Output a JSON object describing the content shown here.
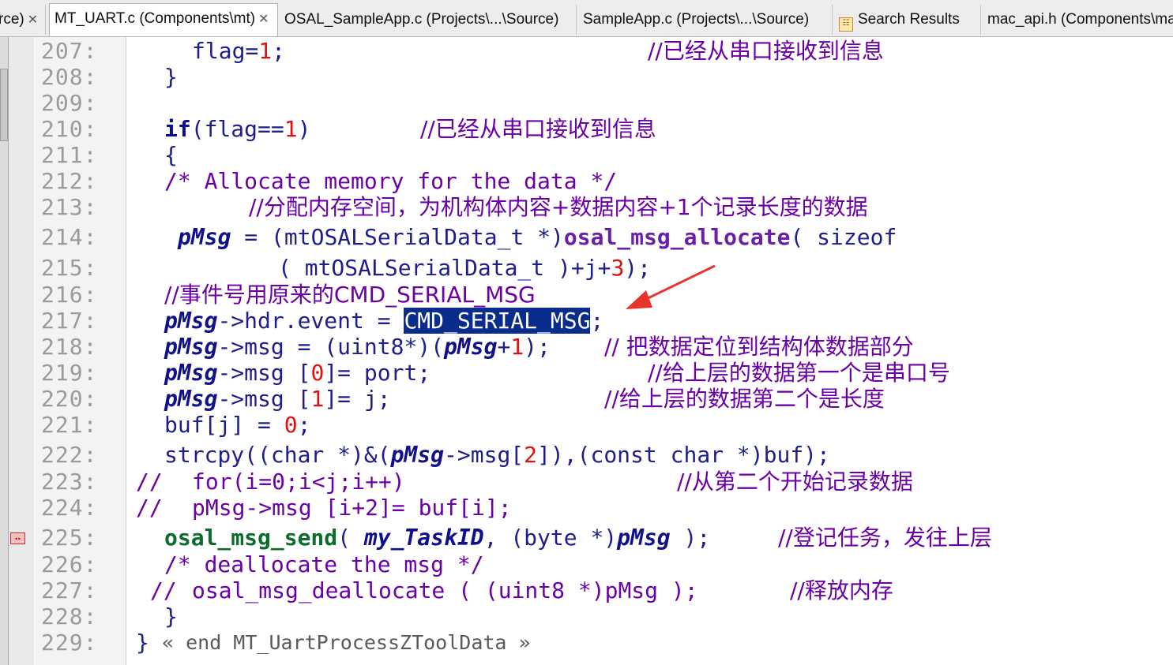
{
  "tabs": [
    {
      "label": "rce)",
      "closable": true
    },
    {
      "label": "MT_UART.c (Components\\mt)",
      "closable": true,
      "active": true
    },
    {
      "label": "OSAL_SampleApp.c (Projects\\...\\Source)",
      "closable": false
    },
    {
      "label": "SampleApp.c (Projects\\...\\Source)",
      "closable": false
    },
    {
      "label": "Search Results",
      "closable": false,
      "icon": "search-results-icon"
    },
    {
      "label": "mac_api.h (Components\\ma",
      "closable": false
    }
  ],
  "lines": [
    {
      "n": "207:"
    },
    {
      "n": "208:"
    },
    {
      "n": "209:"
    },
    {
      "n": "210:"
    },
    {
      "n": "211:"
    },
    {
      "n": "212:"
    },
    {
      "n": "213:"
    },
    {
      "n": "214:"
    },
    {
      "n": "215:"
    },
    {
      "n": "216:"
    },
    {
      "n": "217:"
    },
    {
      "n": "218:"
    },
    {
      "n": "219:"
    },
    {
      "n": "220:"
    },
    {
      "n": "221:"
    },
    {
      "n": "222:"
    },
    {
      "n": "223:"
    },
    {
      "n": "224:"
    },
    {
      "n": "225:"
    },
    {
      "n": "226:"
    },
    {
      "n": "227:"
    },
    {
      "n": "228:"
    },
    {
      "n": "229:"
    }
  ],
  "code": {
    "l207a": "flag=",
    "l207b": "1",
    "l207c": ";",
    "l207d": "//已经从串口接收到信息",
    "l208": "}",
    "l210a": "if",
    "l210b": "(flag==",
    "l210c": "1",
    "l210d": ")",
    "l210e": "//已经从串口接收到信息",
    "l211": "{",
    "l212": "/* Allocate memory for the data */",
    "l213": "//分配内存空间，为机构体内容+数据内容+1个记录长度的数据",
    "l214a": "pMsg",
    "l214b": " = (mtOSALSerialData_t *)",
    "l214c": "osal_msg_allocate",
    "l214d": "( sizeof",
    "l215a": "( mtOSALSerialData_t )+j+",
    "l215b": "3",
    "l215c": ");",
    "l216": "//事件号用原来的CMD_SERIAL_MSG",
    "l217a": "pMsg",
    "l217b": "->hdr.event = ",
    "l217c": "CMD_SERIAL_MSG",
    "l217d": ";",
    "l218a": "pMsg",
    "l218b": "->msg = (uint8*)(",
    "l218c": "pMsg",
    "l218d": "+",
    "l218e": "1",
    "l218f": ");",
    "l218g": "// 把数据定位到结构体数据部分",
    "l219a": "pMsg",
    "l219b": "->msg [",
    "l219c": "0",
    "l219d": "]= port;",
    "l219e": "//给上层的数据第一个是串口号",
    "l220a": "pMsg",
    "l220b": "->msg [",
    "l220c": "1",
    "l220d": "]= j;",
    "l220e": "//给上层的数据第二个是长度",
    "l221a": "buf[j] = ",
    "l221b": "0",
    "l221c": ";",
    "l222a": "strcpy((char *)&(",
    "l222b": "pMsg",
    "l222c": "->msg[",
    "l222d": "2",
    "l222e": "]),(const char *)buf);",
    "l223a": "//",
    "l223b": "for(i=0;i<j;i++)",
    "l223c": "//从第二个开始记录数据",
    "l224a": "//",
    "l224b": "pMsg->msg [i+2]= buf[i];",
    "l225a": "osal_msg_send",
    "l225b": "( ",
    "l225c": "my_TaskID",
    "l225d": ", (byte *)",
    "l225e": "pMsg",
    "l225f": " );",
    "l225g": "//登记任务，发往上层",
    "l226": "/* deallocate the msg */",
    "l227a": "//",
    "l227b": "osal_msg_deallocate ( (uint8 *)pMsg );",
    "l227c": "//释放内存",
    "l228": "}",
    "l229a": "}",
    "l229b": "« end MT_UartProcessZToolData »"
  },
  "colors": {
    "selection": "#0a2d8c",
    "arrow": "#e8342a",
    "comment": "#6b00a6",
    "number": "#e01010"
  }
}
